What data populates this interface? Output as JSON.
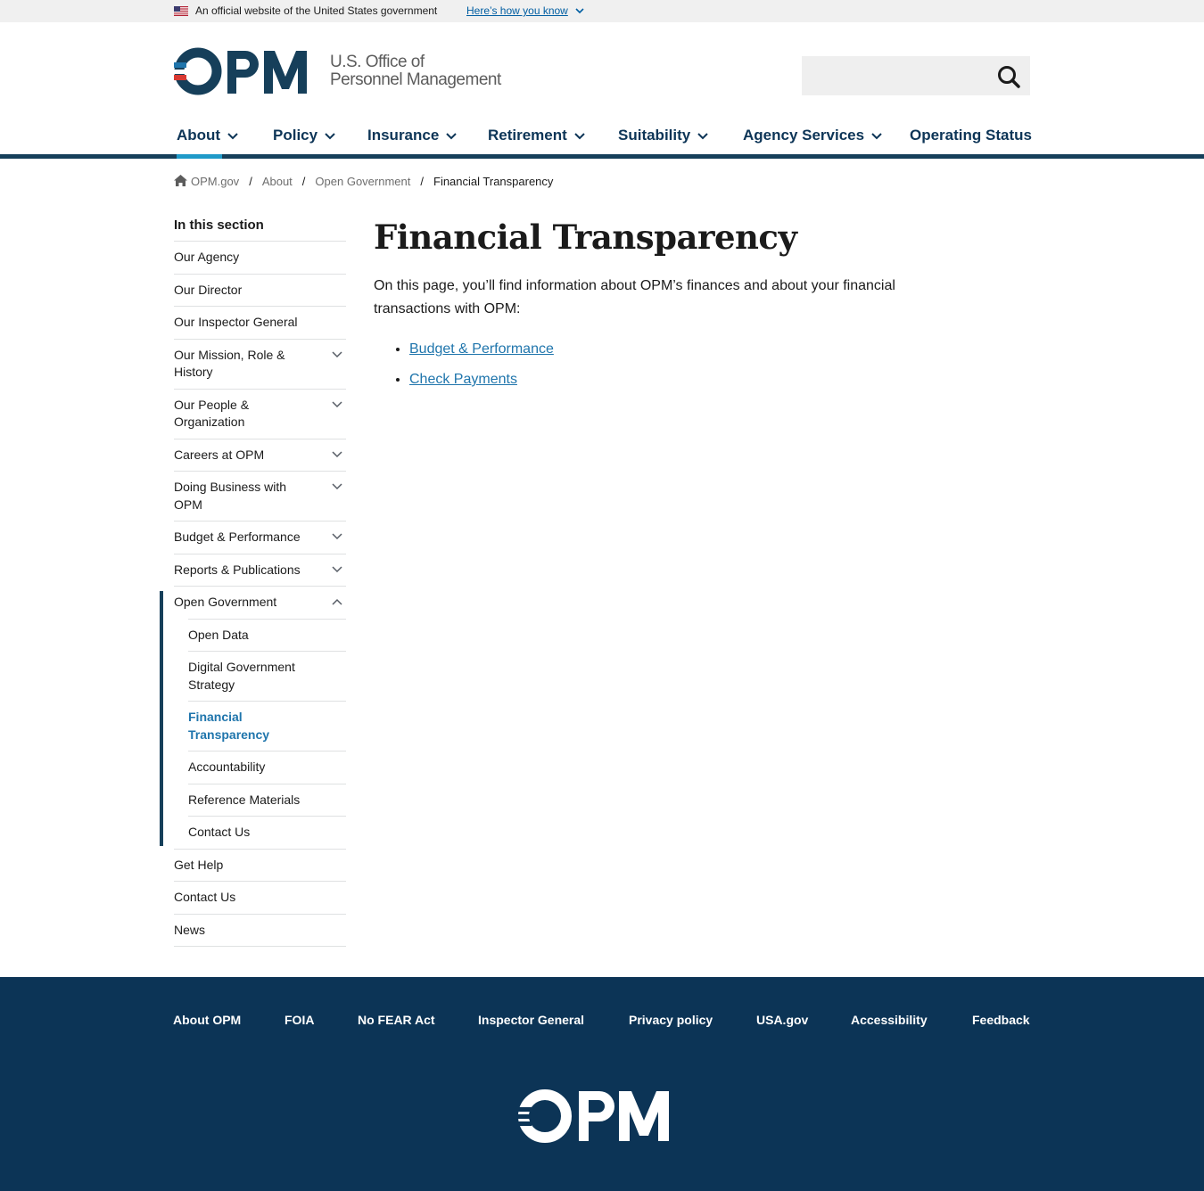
{
  "banner": {
    "official_text": "An official website of the United States government",
    "how_link": "Here’s how you know"
  },
  "header": {
    "logo_text": "OPM",
    "logo_sub1": "U.S. Office of",
    "logo_sub2": "Personnel Management",
    "search_value": "",
    "search_placeholder": ""
  },
  "nav": {
    "items": [
      {
        "label": "About"
      },
      {
        "label": "Policy"
      },
      {
        "label": "Insurance"
      },
      {
        "label": "Retirement"
      },
      {
        "label": "Suitability"
      },
      {
        "label": "Agency Services"
      },
      {
        "label": "Operating Status"
      }
    ]
  },
  "breadcrumb": {
    "items": [
      "OPM.gov",
      "About",
      "Open Government",
      "Financial Transparency"
    ],
    "sep": "/"
  },
  "sidenav": {
    "title": "In this section",
    "items": [
      {
        "label": "Our Agency"
      },
      {
        "label": "Our Director"
      },
      {
        "label": "Our Inspector General"
      },
      {
        "label": "Our Mission, Role & History"
      },
      {
        "label": "Our People & Organization"
      },
      {
        "label": "Careers at OPM"
      },
      {
        "label": "Doing Business with OPM"
      },
      {
        "label": "Budget & Performance"
      },
      {
        "label": "Reports & Publications"
      },
      {
        "label": "Open Government"
      },
      {
        "label": "Get Help"
      },
      {
        "label": "Contact Us"
      },
      {
        "label": "News"
      }
    ],
    "sub_items": [
      {
        "label": "Open Data"
      },
      {
        "label": "Digital Government Strategy"
      },
      {
        "label": "Financial Transparency"
      },
      {
        "label": "Accountability"
      },
      {
        "label": "Reference Materials"
      },
      {
        "label": "Contact Us"
      }
    ]
  },
  "content": {
    "title": "Financial Transparency",
    "intro": "On this page, you’ll find information about OPM’s finances and about your financial transactions with OPM:",
    "links": [
      "Budget & Performance",
      "Check Payments"
    ]
  },
  "footer": {
    "links": [
      "About OPM",
      "FOIA",
      "No FEAR Act",
      "Inspector General",
      "Privacy policy",
      "USA.gov",
      "Accessibility",
      "Feedback"
    ],
    "logo_text": "OPM"
  },
  "colors": {
    "brand_navy": "#0c3456",
    "link_blue": "#1f75ac",
    "accent_red": "#d83933",
    "nav_active": "#1f9ac9"
  }
}
